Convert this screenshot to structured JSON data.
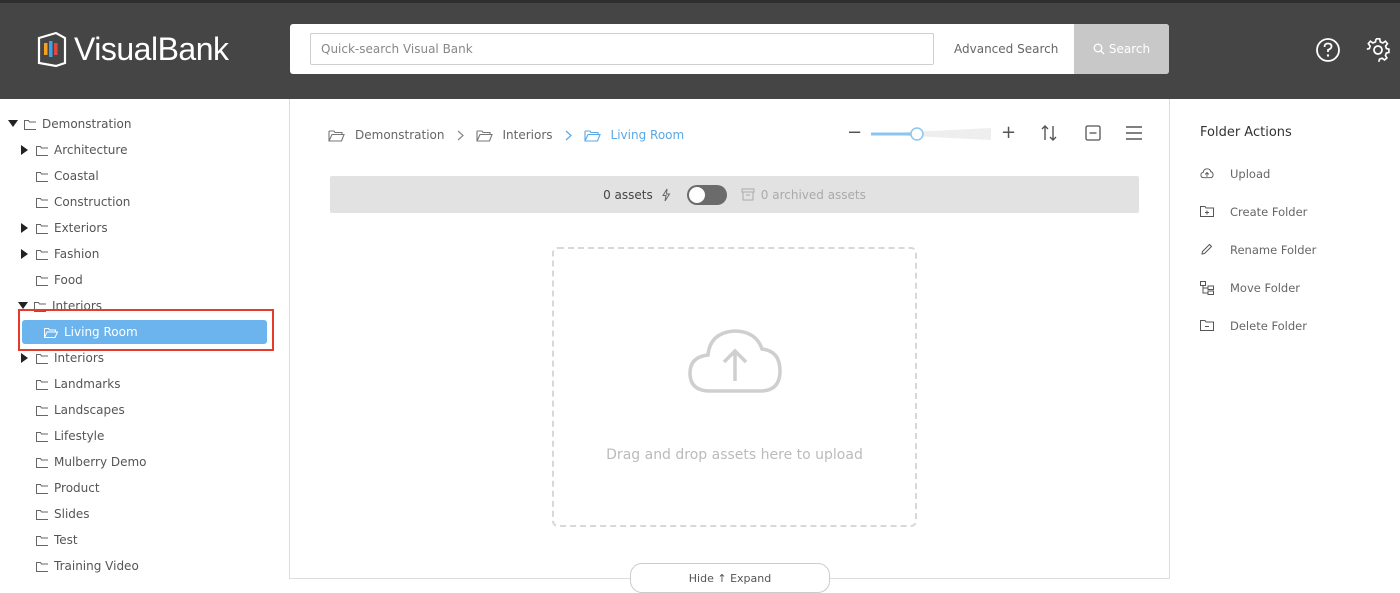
{
  "app": {
    "brand_part1": "Visual",
    "brand_part2": "Bank"
  },
  "header": {
    "search_placeholder": "Quick-search Visual Bank",
    "advanced_search": "Advanced Search",
    "search_button": "Search"
  },
  "sidebar": {
    "items": [
      {
        "label": "Demonstration",
        "expanded": true,
        "has_children": true
      },
      {
        "label": "Architecture",
        "has_children": true
      },
      {
        "label": "Coastal"
      },
      {
        "label": "Construction"
      },
      {
        "label": "Exteriors",
        "has_children": true
      },
      {
        "label": "Fashion",
        "has_children": true
      },
      {
        "label": "Food"
      },
      {
        "label": "Interiors",
        "expanded": true,
        "has_children": true
      },
      {
        "label": "Living Room",
        "selected": true
      },
      {
        "label": "Interiors",
        "has_children": true
      },
      {
        "label": "Landmarks"
      },
      {
        "label": "Landscapes"
      },
      {
        "label": "Lifestyle"
      },
      {
        "label": "Mulberry Demo"
      },
      {
        "label": "Product"
      },
      {
        "label": "Slides"
      },
      {
        "label": "Test"
      },
      {
        "label": "Training Video"
      }
    ]
  },
  "breadcrumb": [
    "Demonstration",
    "Interiors",
    "Living Room"
  ],
  "zoom": {
    "level": 0.37
  },
  "assets": {
    "count_label": "0 assets",
    "archived_label": "0 archived assets"
  },
  "dropzone": {
    "text": "Drag and drop assets here to upload"
  },
  "bottom_tab": {
    "label": "Hide ↑ Expand"
  },
  "folder_actions": {
    "title": "Folder Actions",
    "items": [
      {
        "label": "Upload",
        "icon": "cloud-upload-icon"
      },
      {
        "label": "Create Folder",
        "icon": "folder-plus-icon"
      },
      {
        "label": "Rename Folder",
        "icon": "pencil-icon"
      },
      {
        "label": "Move Folder",
        "icon": "move-folder-icon"
      },
      {
        "label": "Delete Folder",
        "icon": "folder-minus-icon"
      }
    ]
  },
  "colors": {
    "header_bg": "#454545",
    "accent": "#6cb4ee",
    "highlight": "#e53b2c"
  }
}
